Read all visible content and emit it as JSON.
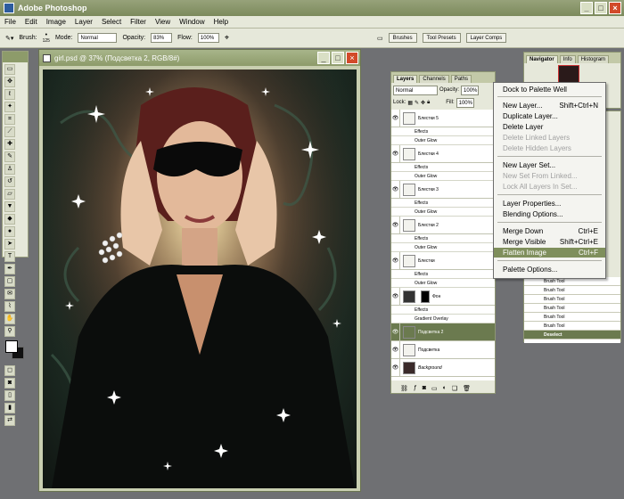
{
  "app": {
    "title": "Adobe Photoshop"
  },
  "menu": [
    "File",
    "Edit",
    "Image",
    "Layer",
    "Select",
    "Filter",
    "View",
    "Window",
    "Help"
  ],
  "options": {
    "brush_label": "Brush:",
    "brush_size": "125",
    "mode_label": "Mode:",
    "mode_value": "Normal",
    "opacity_label": "Opacity:",
    "opacity_value": "83%",
    "flow_label": "Flow:",
    "flow_value": "100%",
    "well_tabs": [
      "Brushes",
      "Tool Presets",
      "Layer Comps"
    ]
  },
  "document": {
    "title": "girl.psd @ 37% (Подсветка 2, RGB/8#)"
  },
  "layers_panel": {
    "tabs": [
      "Layers",
      "Channels",
      "Paths"
    ],
    "blend_mode": "Normal",
    "opacity_label": "Opacity:",
    "opacity": "100%",
    "lock_label": "Lock:",
    "fill_label": "Fill:",
    "fill": "100%",
    "layers": [
      {
        "name": "Блестки 5",
        "sub": [
          "Effects",
          "Outer Glow"
        ]
      },
      {
        "name": "Блестки 4",
        "sub": [
          "Effects",
          "Outer Glow"
        ]
      },
      {
        "name": "Блестки 3",
        "sub": [
          "Effects",
          "Outer Glow"
        ]
      },
      {
        "name": "Блестки 2",
        "sub": [
          "Effects",
          "Outer Glow"
        ]
      },
      {
        "name": "Блестки",
        "sub": [
          "Effects",
          "Outer Glow"
        ]
      },
      {
        "name": "Фон",
        "sub": [
          "Effects",
          "Gradient Overlay"
        ]
      },
      {
        "name": "Подсветка 2",
        "sub": []
      },
      {
        "name": "Подсветка",
        "sub": []
      },
      {
        "name": "Background",
        "sub": []
      }
    ]
  },
  "context_menu": {
    "items": [
      {
        "label": "Dock to Palette Well",
        "shortcut": "",
        "disabled": false
      },
      {
        "label": "New Layer...",
        "shortcut": "Shift+Ctrl+N",
        "disabled": false
      },
      {
        "label": "Duplicate Layer...",
        "shortcut": "",
        "disabled": false
      },
      {
        "label": "Delete Layer",
        "shortcut": "",
        "disabled": false
      },
      {
        "label": "Delete Linked Layers",
        "shortcut": "",
        "disabled": true
      },
      {
        "label": "Delete Hidden Layers",
        "shortcut": "",
        "disabled": true
      },
      {
        "label": "New Layer Set...",
        "shortcut": "",
        "disabled": false
      },
      {
        "label": "New Set From Linked...",
        "shortcut": "",
        "disabled": true
      },
      {
        "label": "Lock All Layers In Set...",
        "shortcut": "",
        "disabled": true
      },
      {
        "label": "Layer Properties...",
        "shortcut": "",
        "disabled": false
      },
      {
        "label": "Blending Options...",
        "shortcut": "",
        "disabled": false
      },
      {
        "label": "Merge Down",
        "shortcut": "Ctrl+E",
        "disabled": false
      },
      {
        "label": "Merge Visible",
        "shortcut": "Shift+Ctrl+E",
        "disabled": false
      },
      {
        "label": "Flatten Image",
        "shortcut": "Ctrl+F",
        "disabled": false
      },
      {
        "label": "Palette Options...",
        "shortcut": "",
        "disabled": false
      }
    ]
  },
  "navigator_panel": {
    "tabs": [
      "Navigator",
      "Info",
      "Histogram"
    ]
  },
  "history_panel": {
    "rows": [
      "Brush Tool",
      "Brush Tool",
      "Brush Tool",
      "Brush Tool",
      "Brush Tool",
      "Brush Tool",
      "Deselect"
    ]
  },
  "colors": {
    "accent": "#7f8f5c",
    "titlebar": "#8d9b6a"
  }
}
